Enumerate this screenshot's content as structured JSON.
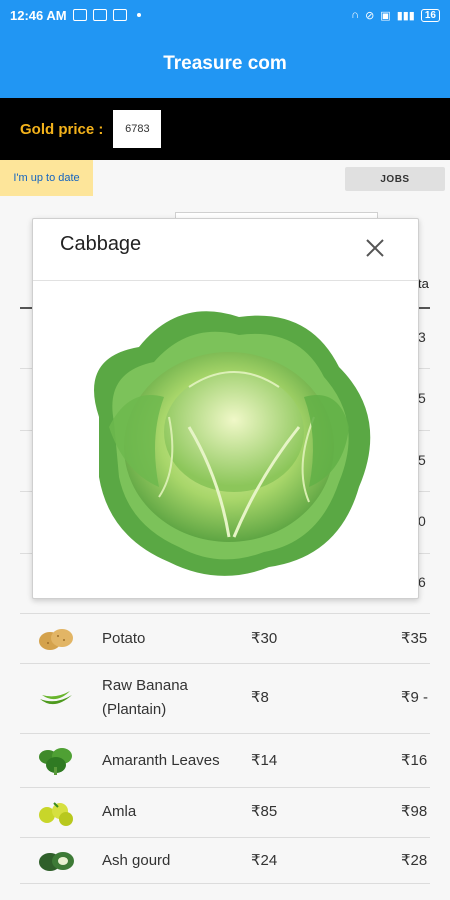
{
  "status_bar": {
    "time": "12:46 AM",
    "battery": "16"
  },
  "app_bar": {
    "title": "Treasure com"
  },
  "gold": {
    "label": "Gold price :",
    "value": "6783"
  },
  "controls": {
    "up_to_date": "I'm up to date",
    "jobs": "JOBS"
  },
  "background_table": {
    "header_peek": "ta",
    "peek_values": [
      "3",
      "5",
      "5",
      "0",
      "6"
    ]
  },
  "modal": {
    "title": "Cabbage",
    "image_icon": "cabbage-image"
  },
  "rows": [
    {
      "name": "Potato",
      "price_1": "₹30",
      "price_2": "₹35",
      "icon": "potato-icon"
    },
    {
      "name": "Raw Banana (Plantain)",
      "price_1": "₹8",
      "price_2": "₹9 -",
      "icon": "raw-banana-icon"
    },
    {
      "name": "Amaranth Leaves",
      "price_1": "₹14",
      "price_2": "₹16",
      "icon": "amaranth-leaves-icon"
    },
    {
      "name": "Amla",
      "price_1": "₹85",
      "price_2": "₹98",
      "icon": "amla-icon"
    },
    {
      "name": "Ash gourd",
      "price_1": "₹24",
      "price_2": "₹28",
      "icon": "ash-gourd-icon"
    }
  ]
}
